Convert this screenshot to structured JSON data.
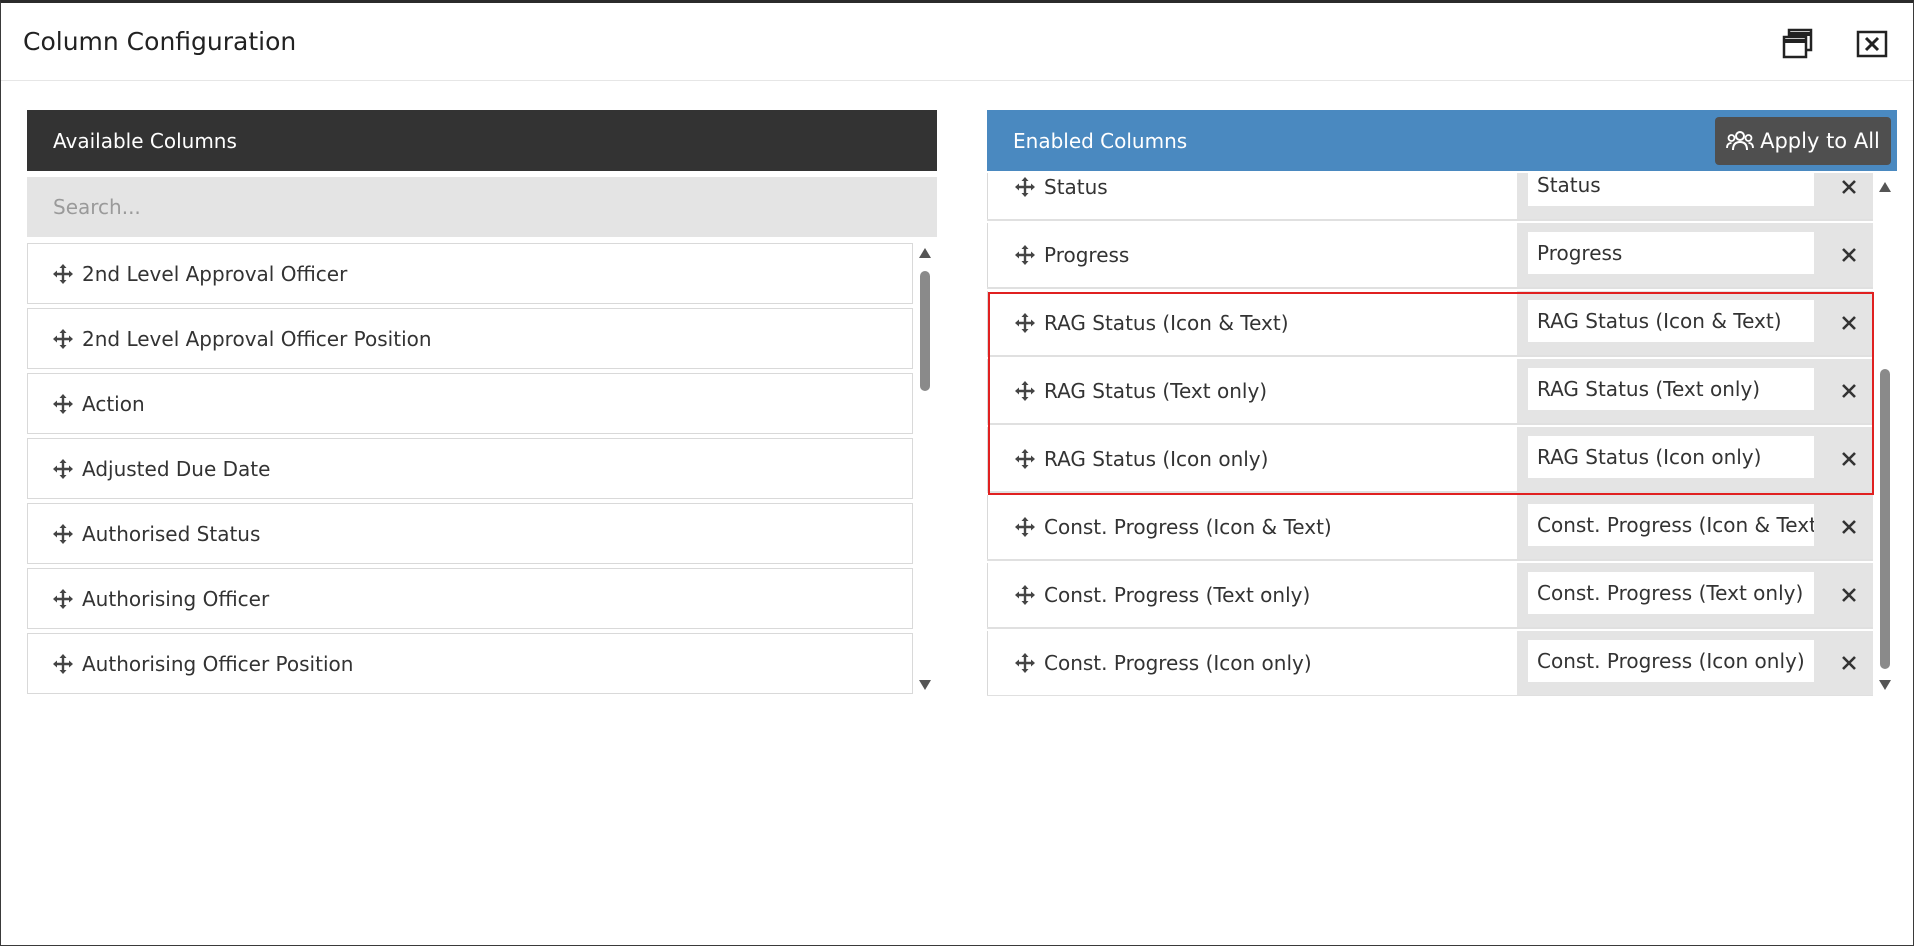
{
  "dialog": {
    "title": "Column Configuration"
  },
  "available": {
    "header": "Available Columns",
    "search_placeholder": "Search...",
    "items": [
      {
        "label": "2nd Level Approval Officer"
      },
      {
        "label": "2nd Level Approval Officer Position"
      },
      {
        "label": "Action"
      },
      {
        "label": "Adjusted Due Date"
      },
      {
        "label": "Authorised Status"
      },
      {
        "label": "Authorising Officer"
      },
      {
        "label": "Authorising Officer Position"
      }
    ]
  },
  "enabled": {
    "header": "Enabled Columns",
    "apply_label": "Apply to All",
    "rows": [
      {
        "name": "Status",
        "alias": "Status"
      },
      {
        "name": "Progress",
        "alias": "Progress"
      },
      {
        "name": "RAG Status (Icon & Text)",
        "alias": "RAG Status (Icon & Text)"
      },
      {
        "name": "RAG Status (Text only)",
        "alias": "RAG Status (Text only)"
      },
      {
        "name": "RAG Status (Icon only)",
        "alias": "RAG Status (Icon only)"
      },
      {
        "name": "Const. Progress (Icon & Text)",
        "alias": "Const. Progress (Icon & Text)"
      },
      {
        "name": "Const. Progress (Text only)",
        "alias": "Const. Progress (Text only)"
      },
      {
        "name": "Const. Progress (Icon only)",
        "alias": "Const. Progress (Icon only)"
      }
    ]
  },
  "colors": {
    "available_header_bg": "#333333",
    "enabled_header_bg": "#4a89c0",
    "apply_button_bg": "#4f4f4f",
    "highlight": "#e02020"
  }
}
